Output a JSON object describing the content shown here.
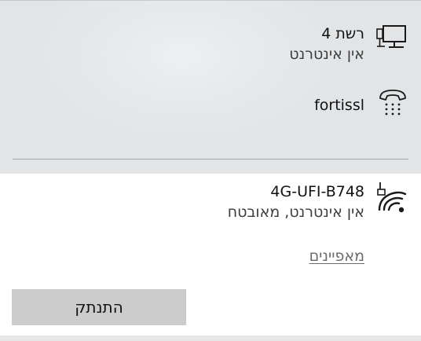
{
  "networks": [
    {
      "name": "רשת 4",
      "status": "אין אינטרנט",
      "icon": "wired-network-icon"
    },
    {
      "name": "fortissl",
      "status": "",
      "icon": "dialup-connection-icon"
    }
  ],
  "connected": {
    "name": "4G-UFI-B748",
    "status": "אין אינטרנט, מאובטח",
    "icon": "wifi-no-internet-icon",
    "properties_label": "מאפיינים",
    "disconnect_label": "התנתק"
  },
  "colors": {
    "top_background": "#e4e6e8",
    "bottom_background": "#ffffff",
    "button_background": "#cccccc",
    "link_color": "#6b6b6b"
  }
}
